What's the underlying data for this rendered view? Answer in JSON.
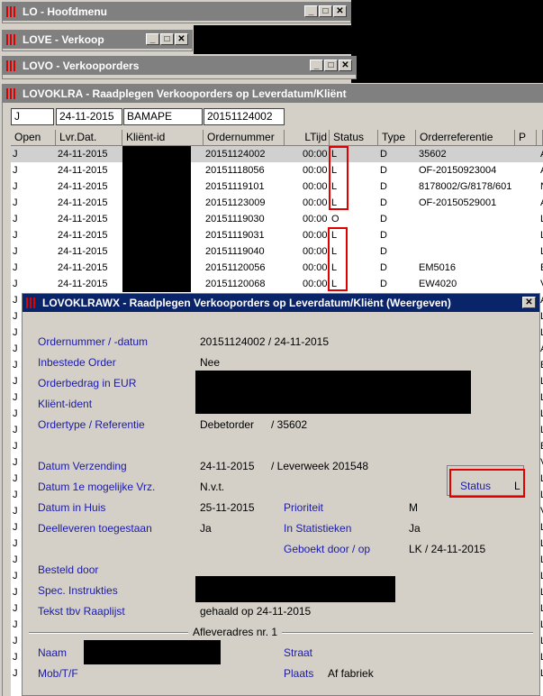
{
  "windows": {
    "hoofdmenu": {
      "title": "LO - Hoofdmenu"
    },
    "verkoop": {
      "title": "LOVE - Verkoop"
    },
    "verkooporders": {
      "title": "LOVO - Verkooporders"
    },
    "raadplegen": {
      "title": "LOVOKLRA - Raadplegen Verkooporders op Leverdatum/Kliënt"
    }
  },
  "filters": {
    "open": "J",
    "date": "24-11-2015",
    "client": "BAMAPE",
    "ordernummer": "20151124002"
  },
  "columns": [
    "Open",
    "Lvr.Dat.",
    "Kliënt-id",
    "Ordernummer",
    "LTijd",
    "Status",
    "Type",
    "Orderreferentie",
    "P"
  ],
  "rows": [
    {
      "open": "J",
      "date": "24-11-2015",
      "order": "20151124002",
      "ltijd": "00:00",
      "status": "L",
      "type": "D",
      "ref": "35602",
      "p": "A"
    },
    {
      "open": "J",
      "date": "24-11-2015",
      "order": "20151118056",
      "ltijd": "00:00",
      "status": "L",
      "type": "D",
      "ref": "OF-20150923004",
      "p": "A"
    },
    {
      "open": "J",
      "date": "24-11-2015",
      "order": "20151119101",
      "ltijd": "00:00",
      "status": "L",
      "type": "D",
      "ref": "8178002/G/8178/601",
      "p": "N"
    },
    {
      "open": "J",
      "date": "24-11-2015",
      "order": "20151123009",
      "ltijd": "00:00",
      "status": "L",
      "type": "D",
      "ref": "OF-20150529001",
      "p": "A"
    },
    {
      "open": "J",
      "date": "24-11-2015",
      "order": "20151119030",
      "ltijd": "00:00",
      "status": "O",
      "type": "D",
      "ref": "",
      "p": "L"
    },
    {
      "open": "J",
      "date": "24-11-2015",
      "order": "20151119031",
      "ltijd": "00:00",
      "status": "L",
      "type": "D",
      "ref": "",
      "p": "L"
    },
    {
      "open": "J",
      "date": "24-11-2015",
      "order": "20151119040",
      "ltijd": "00:00",
      "status": "L",
      "type": "D",
      "ref": "",
      "p": "L"
    },
    {
      "open": "J",
      "date": "24-11-2015",
      "order": "20151120056",
      "ltijd": "00:00",
      "status": "L",
      "type": "D",
      "ref": "EM5016",
      "p": "E"
    },
    {
      "open": "J",
      "date": "24-11-2015",
      "order": "20151120068",
      "ltijd": "00:00",
      "status": "L",
      "type": "D",
      "ref": "EW4020",
      "p": "V"
    }
  ],
  "hidden_rows": {
    "open": [
      "J",
      "J",
      "J",
      "J",
      "J",
      "J",
      "J",
      "J",
      "J",
      "J",
      "J",
      "J",
      "J",
      "J",
      "J",
      "J",
      "J",
      "J",
      "J",
      "J",
      "J",
      "J",
      "J",
      "J"
    ],
    "p": [
      "A",
      "L",
      "L",
      "A",
      "E",
      "L",
      "L",
      "L",
      "L",
      "E",
      "V",
      "L",
      "L",
      "V",
      "L",
      "L",
      "L",
      "L",
      "L",
      "L",
      "L",
      "L",
      "L",
      "L"
    ]
  },
  "detail": {
    "title": "LOVOKLRAWX - Raadplegen Verkooporders op Leverdatum/Kliënt (Weergeven)",
    "ordernummer_label": "Ordernummer / -datum",
    "ordernummer_value": "20151124002 / 24-11-2015",
    "inbestede_label": "Inbestede Order",
    "inbestede_value": "Nee",
    "orderbedrag_label": "Orderbedrag in EUR",
    "klient_label": "Kliënt-ident",
    "ordertype_label": "Ordertype / Referentie",
    "ordertype_value": "Debetorder",
    "referentie_value": "/ 35602",
    "verzending_label": "Datum Verzending",
    "verzending_value": "24-11-2015",
    "leverweek_value": "/ Leverweek 201548",
    "mogelijk_label": "Datum 1e mogelijke Vrz.",
    "mogelijk_value": "N.v.t.",
    "status_label": "Status",
    "status_value": "L",
    "inhuis_label": "Datum in Huis",
    "inhuis_value": "25-11-2015",
    "prioriteit_label": "Prioriteit",
    "prioriteit_value": "M",
    "deelleveren_label": "Deelleveren toegestaan",
    "deelleveren_value": "Ja",
    "statistieken_label": "In Statistieken",
    "statistieken_value": "Ja",
    "geboekt_label": "Geboekt door / op",
    "geboekt_value": "LK / 24-11-2015",
    "besteld_label": "Besteld door",
    "spec_label": "Spec. Instrukties",
    "tekst_label": "Tekst tbv Raaplijst",
    "tekst_value": "gehaald op 24-11-2015",
    "afleveradres_label": "Afleveradres nr. 1",
    "naam_label": "Naam",
    "straat_label": "Straat",
    "mob_label": "Mob/T/F",
    "plaats_label": "Plaats",
    "plaats_value": "Af fabriek"
  },
  "icons": {
    "minimize": "_",
    "maximize": "□",
    "close": "✕"
  },
  "colors": {
    "label_blue": "#1a1aa8",
    "highlight_red": "#e00000",
    "titlebar_active": "#0a246a",
    "titlebar_inactive": "#808080"
  }
}
